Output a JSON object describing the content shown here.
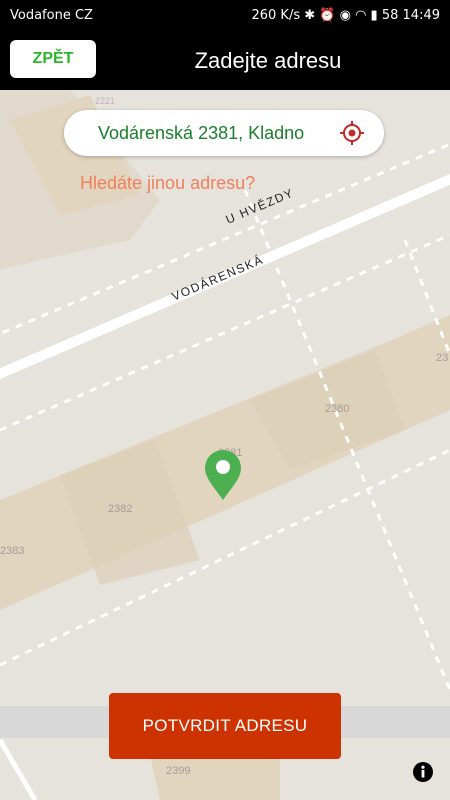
{
  "status_bar": {
    "carrier": "Vodafone CZ",
    "speed": "260 K/s",
    "battery": "58",
    "time": "14:49"
  },
  "header": {
    "back_label": "ZPĚT",
    "title": "Zadejte adresu"
  },
  "address": {
    "value": "Vodárenská 2381, Kladno",
    "locate_icon": "crosshair-icon"
  },
  "other_address_link": "Hledáte jinou adresu?",
  "map": {
    "streets": [
      "U HVĚZDY",
      "VODÁRENSKÁ"
    ],
    "building_numbers": [
      "2381",
      "2380",
      "2382",
      "2383",
      "2399",
      "23",
      "2221"
    ]
  },
  "confirm_button": "POTVRDIT ADRESU",
  "colors": {
    "accent_green": "#2cb52c",
    "confirm_red": "#cc3300",
    "link_orange": "#f0805a"
  }
}
